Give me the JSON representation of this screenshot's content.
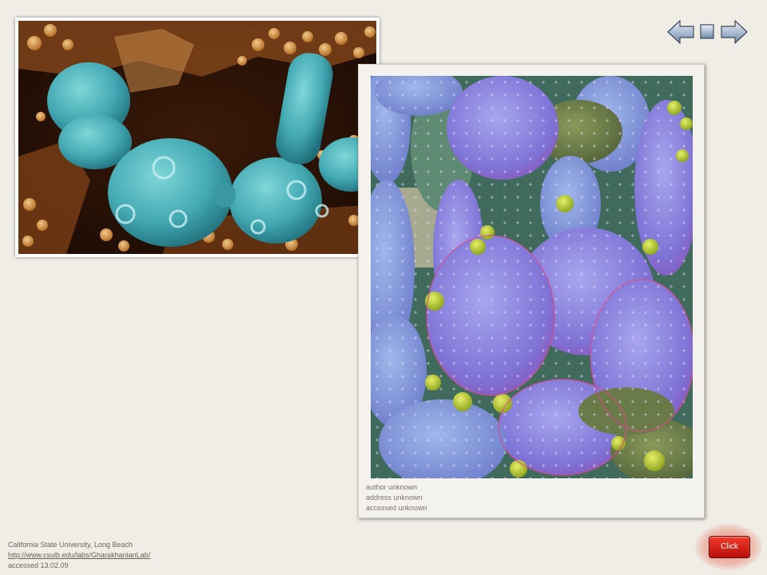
{
  "left_photo": {
    "credit": {
      "institution": "California State University, Long Beach",
      "url": "http://www.csulb.edu/labs/GharakhanianLab/",
      "accessed": "accessed  13.02.09"
    }
  },
  "right_photo": {
    "credit": {
      "author": "author unknown",
      "address": "address unknown",
      "accessed": "accessed  unknown"
    }
  },
  "click_button": {
    "label": "Click"
  },
  "colors": {
    "background": "#efede6",
    "button_red": "#e0231a",
    "nav_blue": "#7a93b2"
  },
  "icons": [
    "arrow-left-icon",
    "stop-icon",
    "arrow-right-icon"
  ]
}
